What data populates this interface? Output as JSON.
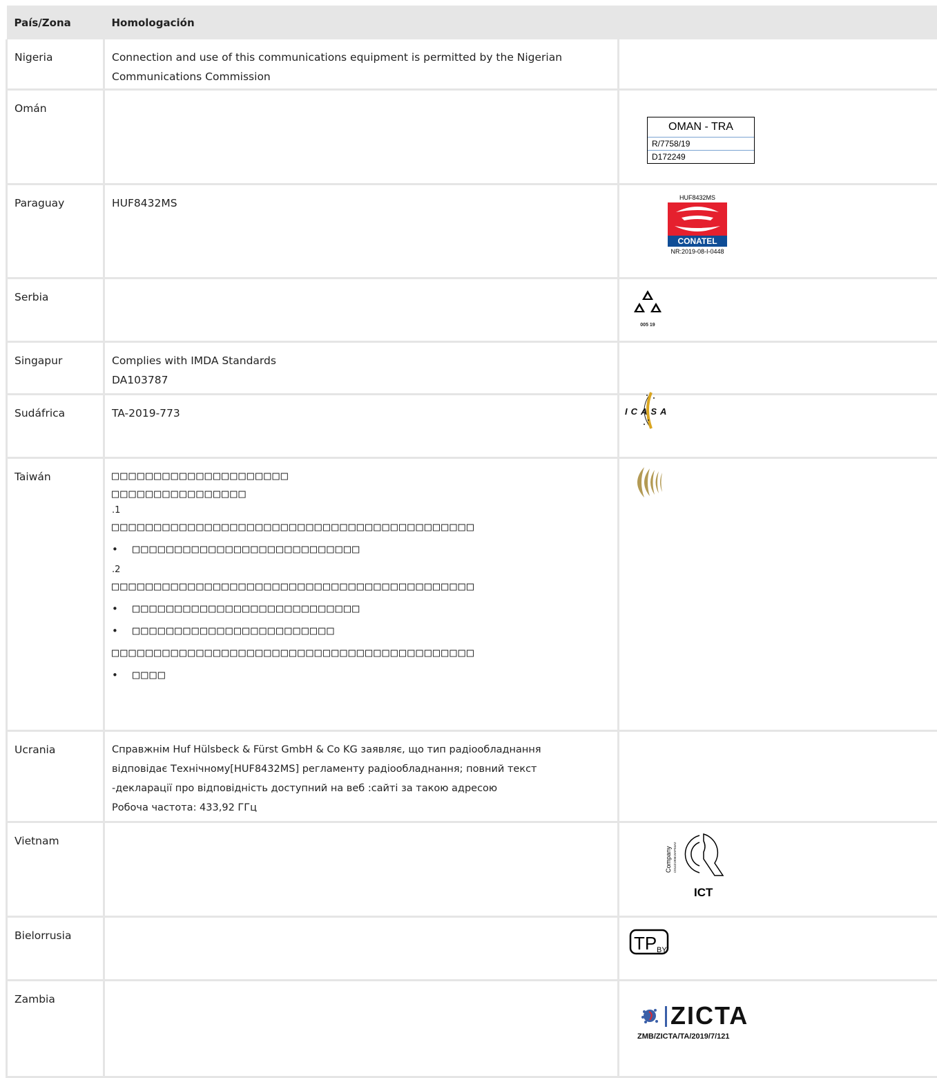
{
  "header": {
    "col1": "País/Zona",
    "col2": "Homologación"
  },
  "rows": {
    "nigeria": {
      "country": "Nigeria",
      "text": "Connection and use of this communications equipment is permitted by the Nigerian Communications Commission"
    },
    "oman": {
      "country": "Omán",
      "logo_title": "OMAN - TRA",
      "logo_line1": "R/7758/19",
      "logo_line2": "D172249"
    },
    "paraguay": {
      "country": "Paraguay",
      "text": "HUF8432MS",
      "logo_top": "HUF8432MS",
      "logo_label": "CONATEL",
      "logo_bottom": "NR:2019-08-I-0448"
    },
    "serbia": {
      "country": "Serbia",
      "logo_numbers": "005  19"
    },
    "singapur": {
      "country": "Singapur",
      "line1": "Complies with IMDA Standards",
      "line2": "DA103787"
    },
    "sudafrica": {
      "country": "Sudáfrica",
      "text": "TA-2019-773",
      "logo_text": "ICASA"
    },
    "taiwan": {
      "country": "Taiwán",
      "l1": "□□□□□□□□□□□□□□□□□□□□□",
      "l2": "□□□□□□□□□□□□□□□□",
      "n1": ".1",
      "l3": "□□□□□□□□□□□□□□□□□□□□□□□□□□□□□□□□□□□□□□□□□□□",
      "b1": "□□□□□□□□□□□□□□□□□□□□□□□□□□□",
      "n2": ".2",
      "l4": "□□□□□□□□□□□□□□□□□□□□□□□□□□□□□□□□□□□□□□□□□□□",
      "b2": "□□□□□□□□□□□□□□□□□□□□□□□□□□□",
      "b3": "□□□□□□□□□□□□□□□□□□□□□□□□",
      "l5": "□□□□□□□□□□□□□□□□□□□□□□□□□□□□□□□□□□□□□□□□□□□",
      "b4": "□□□□"
    },
    "ucrania": {
      "country": "Ucrania",
      "l1": "Справжнім Huf Hülsbeck & Fürst GmbH & Co KG заявляє, що тип радіообладнання",
      "l2": "відповідає Технічному[HUF8432MS] регламенту радіообладнання; повний текст",
      "l3": "-декларації про відповідність доступний на веб :сайті за такою адресою",
      "l4": "Робоча частота: 433,92 ГГц"
    },
    "vietnam": {
      "country": "Vietnam",
      "logo_side1": "Company",
      "logo_side2": "C0142190619AF04A2",
      "logo_label": "ICT"
    },
    "bielorrusia": {
      "country": "Bielorrusia",
      "logo_main": "TP",
      "logo_sub": "BY"
    },
    "zambia": {
      "country": "Zambia",
      "logo_word": "ZICTA",
      "logo_sub_a": "ZMB/ZICTA/TA/",
      "logo_sub_b": "2019/7/121"
    }
  }
}
